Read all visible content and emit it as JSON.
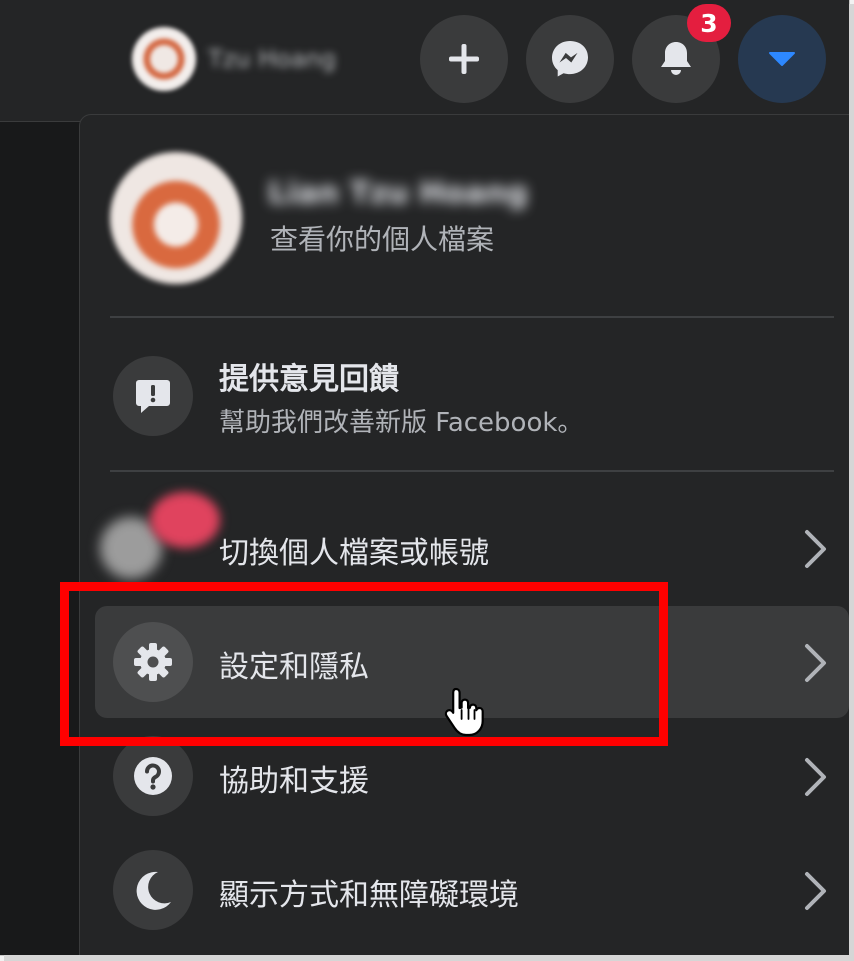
{
  "topbar": {
    "user_name": "Tzu Hoang",
    "notification_count": "3",
    "buttons": [
      "plus-icon",
      "messenger-icon",
      "bell-icon",
      "caret-down-icon"
    ]
  },
  "menu": {
    "profile": {
      "name": "Lian Tzu Hoang",
      "subtitle": "查看你的個人檔案"
    },
    "feedback": {
      "title": "提供意見回饋",
      "subtitle": "幫助我們改善新版 Facebook。"
    },
    "items": [
      {
        "label": "切換個人檔案或帳號",
        "icon": "switch-profile-avatars"
      },
      {
        "label": "設定和隱私",
        "icon": "gear-icon"
      },
      {
        "label": "協助和支援",
        "icon": "question-icon"
      },
      {
        "label": "顯示方式和無障礙環境",
        "icon": "moon-icon"
      }
    ]
  },
  "colors": {
    "background": "#18191a",
    "surface": "#242526",
    "hover": "#3a3b3c",
    "badge": "#e41e3f",
    "accent": "#2d88ff",
    "highlight_box": "#ff0000"
  }
}
